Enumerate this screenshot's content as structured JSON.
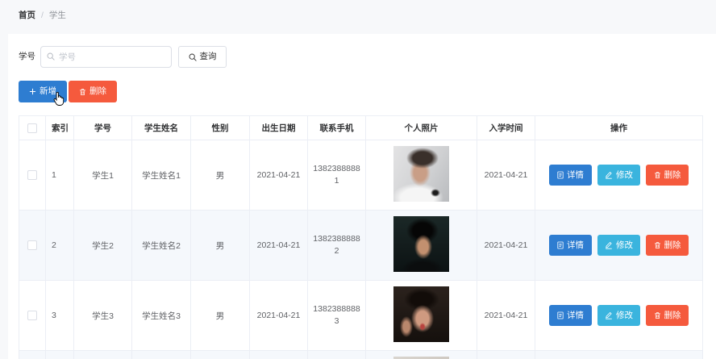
{
  "breadcrumb": {
    "home": "首页",
    "separator": "/",
    "current": "学生"
  },
  "search": {
    "label": "学号",
    "placeholder": "学号",
    "value": "",
    "query_button": "查询"
  },
  "toolbar": {
    "add_button": "新增",
    "delete_button": "删除"
  },
  "table": {
    "columns": [
      "索引",
      "学号",
      "学生姓名",
      "性别",
      "出生日期",
      "联系手机",
      "个人照片",
      "入学时间",
      "操作"
    ],
    "rows": [
      {
        "index": "1",
        "student_id": "学生1",
        "name": "学生姓名1",
        "gender": "男",
        "birth_date": "2021-04-21",
        "phone": "13823888881",
        "enroll_date": "2021-04-21"
      },
      {
        "index": "2",
        "student_id": "学生2",
        "name": "学生姓名2",
        "gender": "男",
        "birth_date": "2021-04-21",
        "phone": "13823888882",
        "enroll_date": "2021-04-21"
      },
      {
        "index": "3",
        "student_id": "学生3",
        "name": "学生姓名3",
        "gender": "男",
        "birth_date": "2021-04-21",
        "phone": "13823888883",
        "enroll_date": "2021-04-21"
      }
    ],
    "row_actions": {
      "detail": "详情",
      "edit": "修改",
      "delete": "删除"
    }
  },
  "icons": {
    "search": "search-icon",
    "add": "plus-icon",
    "delete": "trash-icon",
    "detail": "document-icon",
    "edit": "edit-icon",
    "cursor": "hand-pointer-icon"
  },
  "colors": {
    "primary": "#2e7dd1",
    "info": "#3ab4de",
    "danger": "#f55a3d",
    "stripe": "#f5f8fc",
    "border": "#ebeef5"
  }
}
